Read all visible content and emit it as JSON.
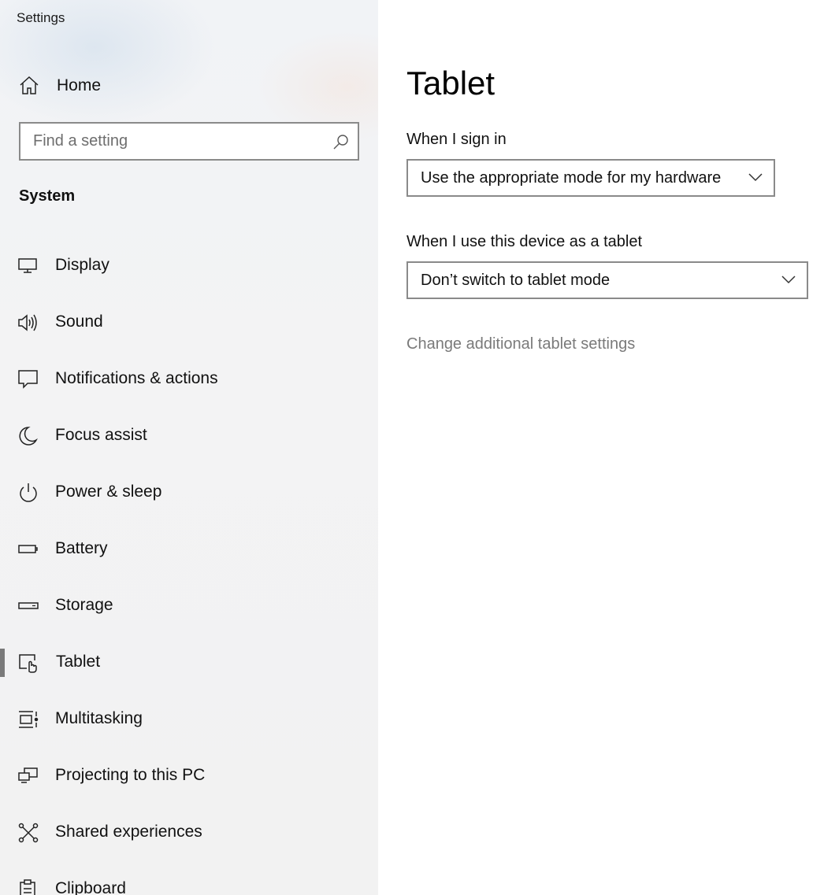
{
  "window": {
    "title": "Settings"
  },
  "sidebar": {
    "home_label": "Home",
    "search": {
      "placeholder": "Find a setting"
    },
    "section_title": "System",
    "items": [
      {
        "label": "Display",
        "icon": "display-icon"
      },
      {
        "label": "Sound",
        "icon": "speaker-icon"
      },
      {
        "label": "Notifications & actions",
        "icon": "notification-icon"
      },
      {
        "label": "Focus assist",
        "icon": "moon-icon"
      },
      {
        "label": "Power & sleep",
        "icon": "power-icon"
      },
      {
        "label": "Battery",
        "icon": "battery-icon"
      },
      {
        "label": "Storage",
        "icon": "storage-icon"
      },
      {
        "label": "Tablet",
        "icon": "tablet-icon",
        "selected": true
      },
      {
        "label": "Multitasking",
        "icon": "multitasking-icon"
      },
      {
        "label": "Projecting to this PC",
        "icon": "projecting-icon"
      },
      {
        "label": "Shared experiences",
        "icon": "shared-experiences-icon"
      },
      {
        "label": "Clipboard",
        "icon": "clipboard-icon"
      }
    ]
  },
  "main": {
    "title": "Tablet",
    "sign_in": {
      "label": "When I sign in",
      "selected_value": "Use the appropriate mode for my hardware"
    },
    "tablet_use": {
      "label": "When I use this device as a tablet",
      "selected_value": "Don’t switch to tablet mode"
    },
    "additional_link": "Change additional tablet settings"
  },
  "colors": {
    "sidebar_background": "#f2f2f2",
    "selection_indicator": "#7a7a7a",
    "border": "#8a8a8a",
    "link_text": "#7a7a7a"
  }
}
